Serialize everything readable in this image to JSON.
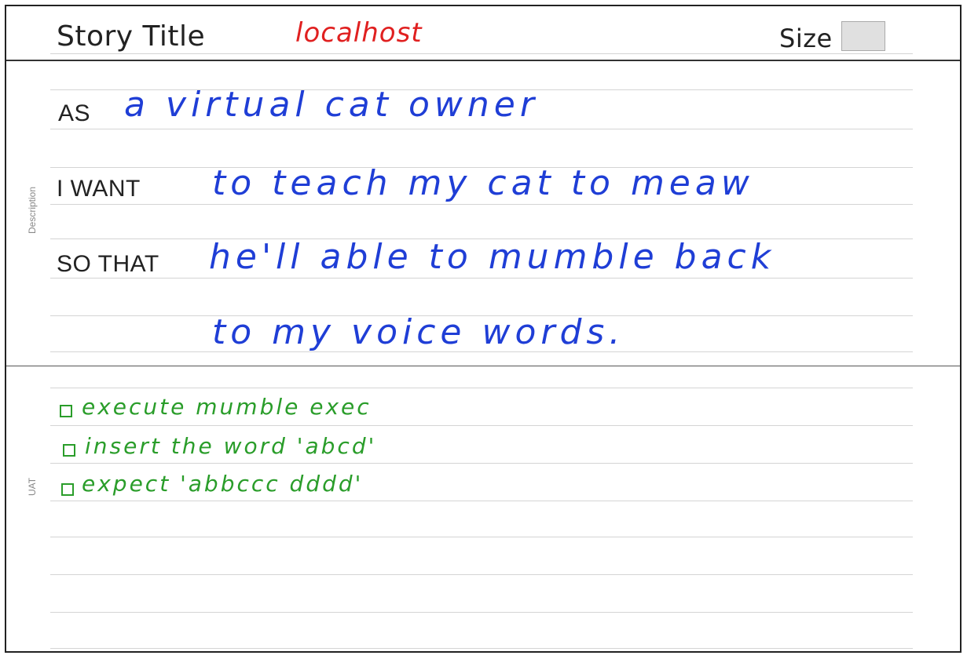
{
  "header": {
    "story_title_label": "Story Title",
    "story_title_value": "localhost",
    "size_label": "Size"
  },
  "description": {
    "section_label": "Description",
    "lines": [
      {
        "prefix": "AS",
        "text": "a virtual cat owner"
      },
      {
        "prefix": "I WANT",
        "text": "to teach my cat to meaw"
      },
      {
        "prefix": "SO THAT",
        "text": "he'll able to mumble back"
      },
      {
        "prefix": "",
        "text": "to my voice words."
      }
    ]
  },
  "uat": {
    "section_label": "UAT",
    "items": [
      "execute mumble exec",
      "insert the word 'abcd'",
      "expect 'abbccc dddd'"
    ]
  },
  "colors": {
    "title_ink": "#e02020",
    "description_ink": "#1f3ed6",
    "uat_ink": "#2a9d2a"
  }
}
